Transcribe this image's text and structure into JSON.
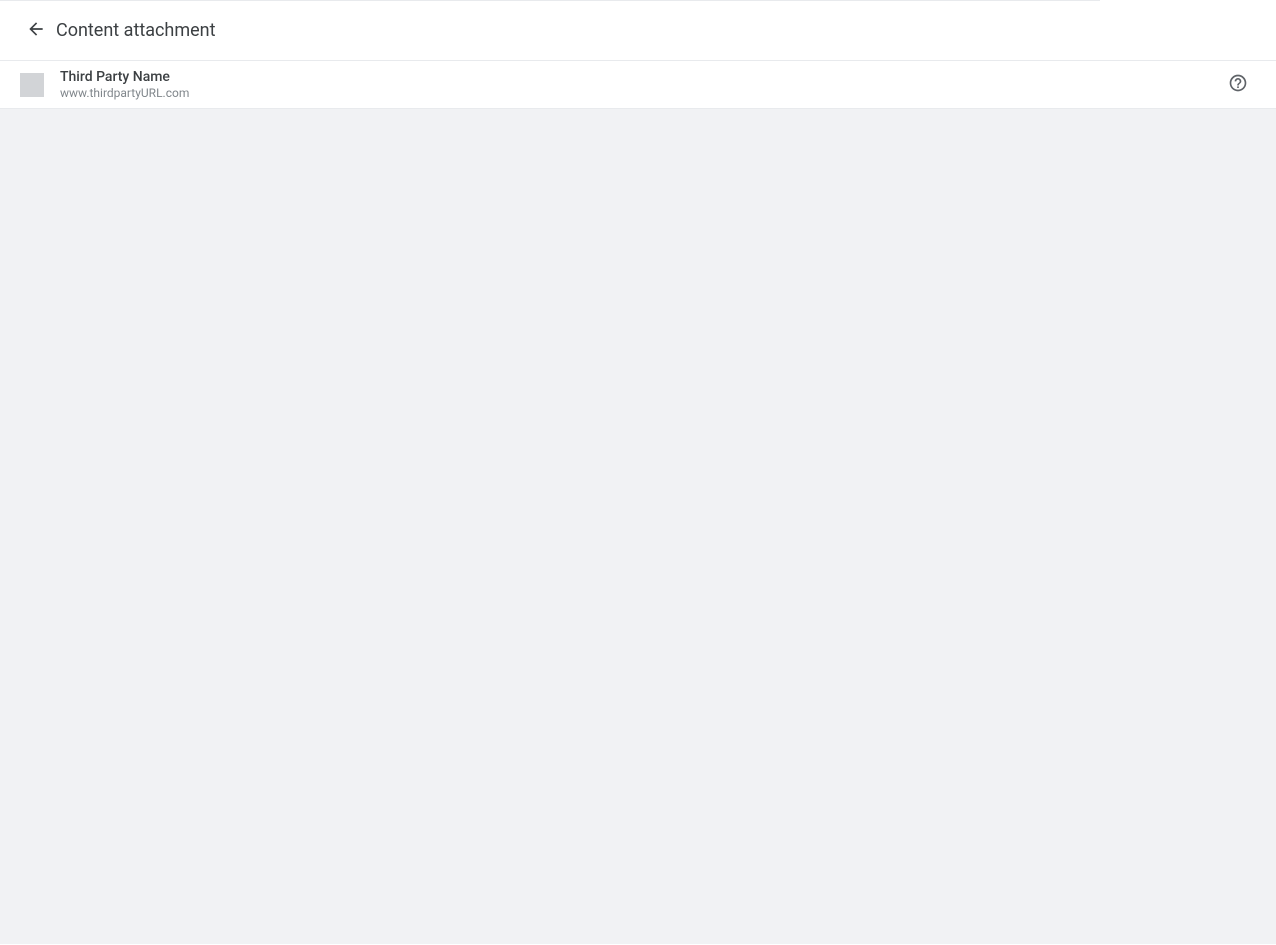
{
  "header": {
    "title": "Content attachment"
  },
  "subheader": {
    "thirdPartyName": "Third Party Name",
    "thirdPartyUrl": "www.thirdpartyURL.com"
  }
}
